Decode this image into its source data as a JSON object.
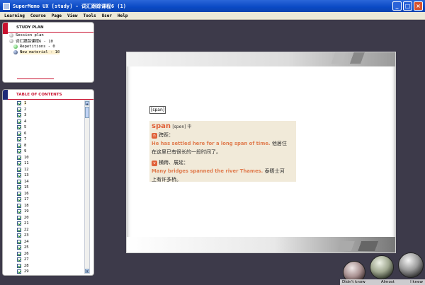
{
  "window": {
    "title": "SuperMemo UX [study] - 词汇跟踪课程6 (1)",
    "minimize": "_",
    "maximize": "□",
    "close": "×"
  },
  "menu": [
    "Learning",
    "Course",
    "Page",
    "View",
    "Tools",
    "User",
    "Help"
  ],
  "study_plan": {
    "title": "STUDY PLAN",
    "items": [
      {
        "label": "Session plan"
      },
      {
        "label": "词汇跟踪课程6 - 10"
      },
      {
        "label": "Repetitions - 0"
      },
      {
        "label": "New material - 10"
      }
    ]
  },
  "toc": {
    "title": "TABLE OF CONTENTS",
    "items": [
      "1",
      "2",
      "3",
      "4",
      "5",
      "6",
      "7",
      "8",
      "9",
      "10",
      "11",
      "12",
      "13",
      "14",
      "15",
      "16",
      "17",
      "18",
      "19",
      "20",
      "21",
      "22",
      "23",
      "24",
      "25",
      "26",
      "27",
      "28",
      "29"
    ],
    "scroll_up": "▲",
    "scroll_down": "▼"
  },
  "card": {
    "question": "[span]",
    "word": "span",
    "phonetic": "[spen] 中",
    "sense1_badge": "n",
    "sense1_meaning": "跨距：",
    "sense1_example_en": "He has settled here for a long span of time.",
    "sense1_example_zh_a": "他居住",
    "sense1_example_zh_b": "在这里已有很长的一段时间了。",
    "sense2_badge": "v",
    "sense2_meaning": "横跨、展延：",
    "sense2_example_en": "Many bridges spanned the river Thames.",
    "sense2_example_zh_a": "泰晤士河",
    "sense2_example_zh_b": "上有许多桥。"
  },
  "grades": {
    "didnt_know": "Didn't know",
    "almost": "Almost",
    "i_knew": "I knew"
  }
}
